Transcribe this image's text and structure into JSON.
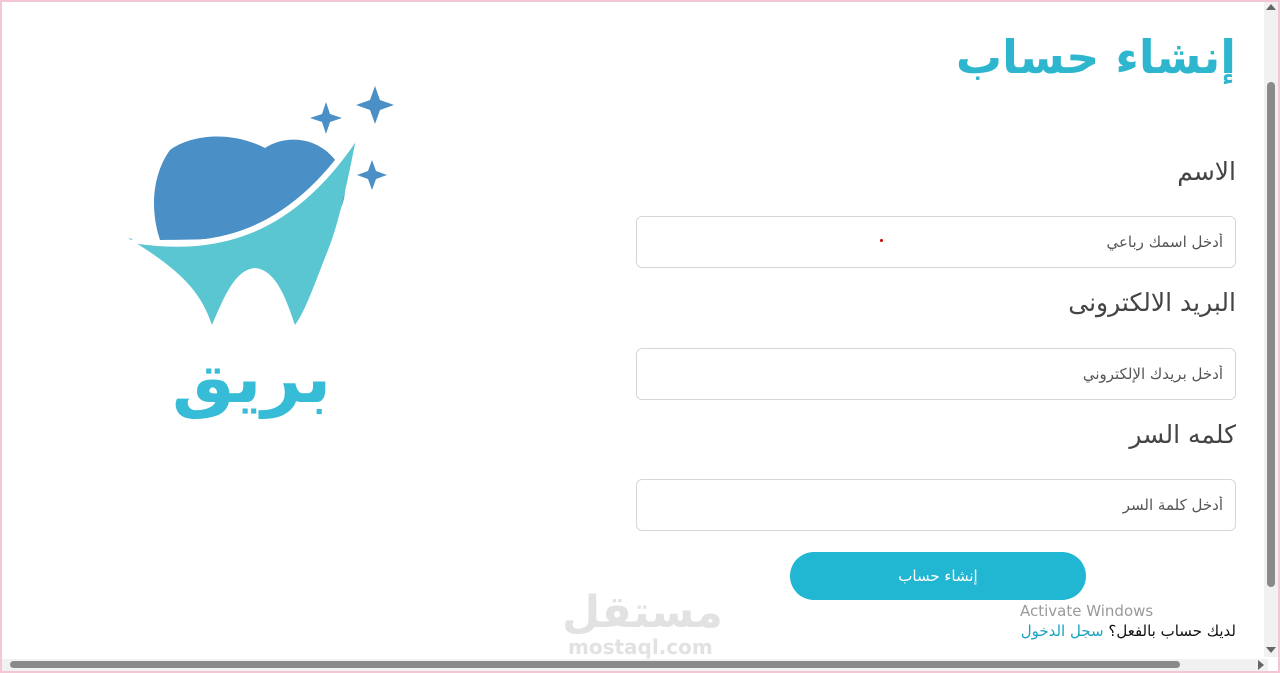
{
  "form": {
    "title": "إنشاء حساب",
    "name_label": "الاسم",
    "name_placeholder": "أدخل اسمك رباعي",
    "email_label": "البريد الالكترونى",
    "email_placeholder": "أدخل بريدك الإلكتروني",
    "password_label": "كلمه السر",
    "password_placeholder": "أدخل كلمة السر",
    "submit_label": "إنشاء حساب",
    "have_account_text": "لديك حساب بالفعل؟",
    "login_link": "سجل الدخول"
  },
  "brand": {
    "name": "بريق",
    "logo_icon": "tooth-sparkle-icon",
    "colors": {
      "primary": "#2fb6cf",
      "logo_dark": "#4a8fc5",
      "logo_light": "#59c6d2"
    }
  },
  "system": {
    "activate_windows": "Activate Windows"
  },
  "watermark": {
    "arabic": "مستقل",
    "latin": "mostaql.com"
  }
}
